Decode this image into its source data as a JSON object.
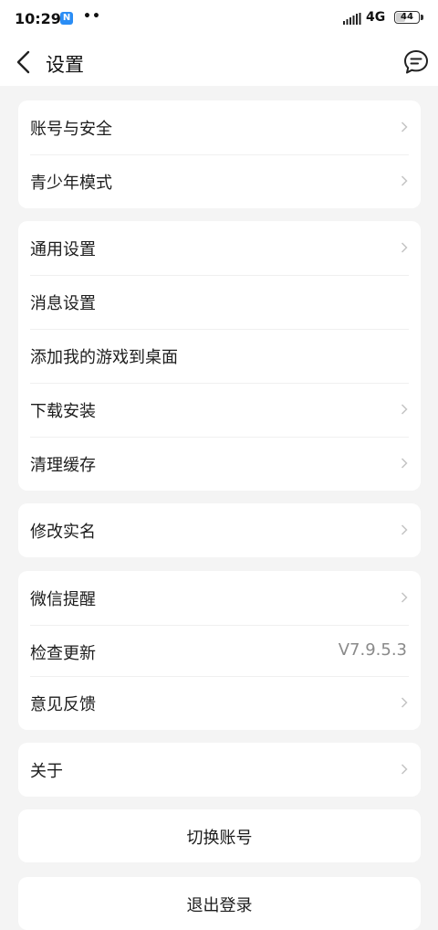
{
  "status_bar": {
    "time": "10:29",
    "notif_badge": "N",
    "dots": "••",
    "network": "4G",
    "battery": "44",
    "battery_percent": 44
  },
  "header": {
    "title": "设置",
    "back_icon": "chevron-left-icon",
    "message_icon": "chat-bubble-icon"
  },
  "groups": {
    "account": [
      {
        "label": "账号与安全",
        "chevron": true
      },
      {
        "label": "青少年模式",
        "chevron": true
      }
    ],
    "general": [
      {
        "label": "通用设置",
        "chevron": true
      },
      {
        "label": "消息设置",
        "chevron": false
      },
      {
        "label": "添加我的游戏到桌面",
        "chevron": false
      },
      {
        "label": "下载安装",
        "chevron": true
      },
      {
        "label": "清理缓存",
        "chevron": true
      }
    ],
    "realname": [
      {
        "label": "修改实名",
        "chevron": true
      }
    ],
    "misc": [
      {
        "label": "微信提醒",
        "chevron": true
      },
      {
        "label": "检查更新",
        "value": "V7.9.5.3"
      },
      {
        "label": "意见反馈",
        "chevron": true
      }
    ],
    "about": [
      {
        "label": "关于",
        "chevron": true
      }
    ]
  },
  "buttons": {
    "switch_account": "切换账号",
    "logout": "退出登录"
  },
  "colors": {
    "background": "#f4f4f4",
    "card": "#ffffff",
    "chevron": "#c4c4c4",
    "value_text": "#8a8a8a",
    "badge": "#2a8df5"
  }
}
